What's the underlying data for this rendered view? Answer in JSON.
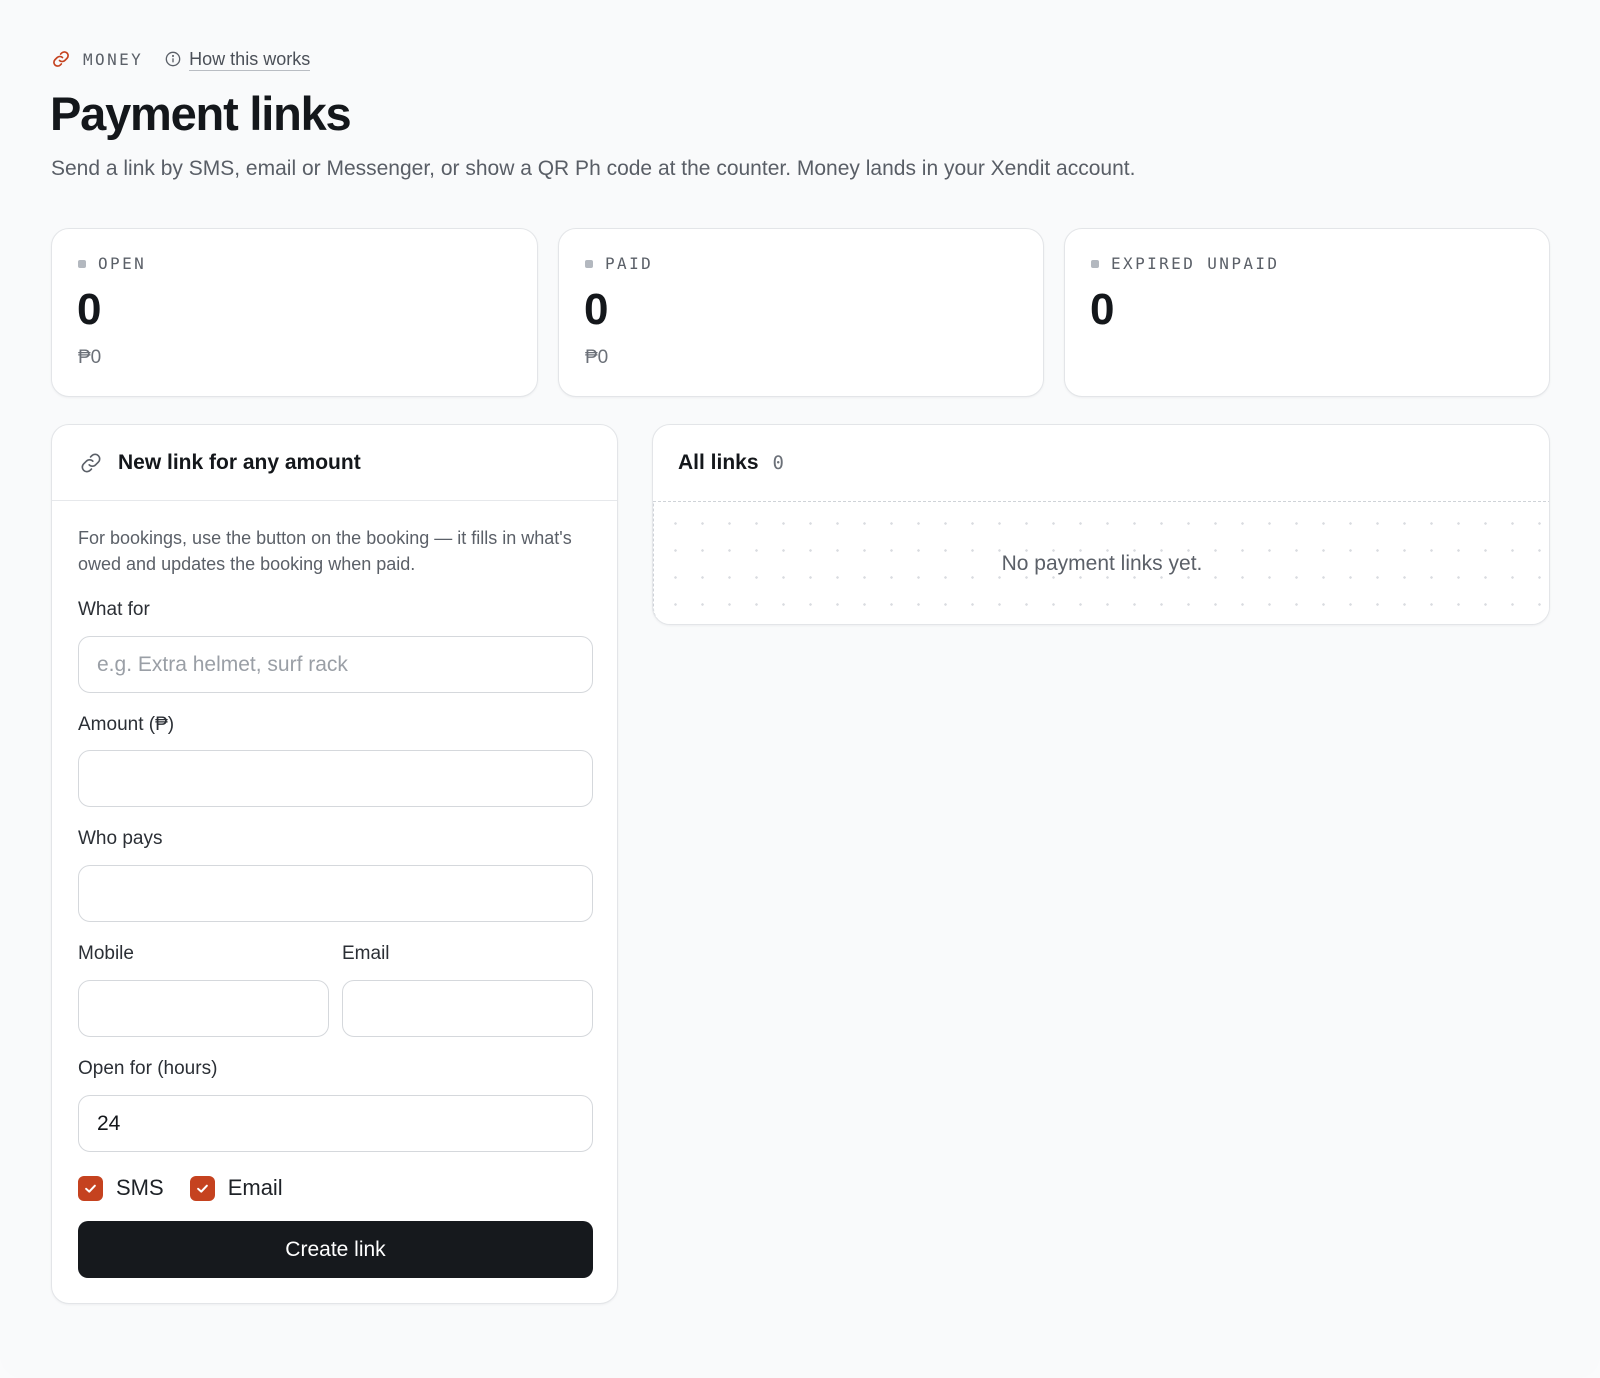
{
  "header": {
    "section_label": "MONEY",
    "how_link": "How this works",
    "title": "Payment links",
    "subtitle": "Send a link by SMS, email or Messenger, or show a QR Ph code at the counter. Money lands in your Xendit account."
  },
  "stats": [
    {
      "label": "OPEN",
      "count": "0",
      "amount": "₱0"
    },
    {
      "label": "PAID",
      "count": "0",
      "amount": "₱0"
    },
    {
      "label": "EXPIRED UNPAID",
      "count": "0"
    }
  ],
  "form": {
    "heading": "New link for any amount",
    "hint": "For bookings, use the button on the booking — it fills in what's owed and updates the booking when paid.",
    "what_for": {
      "label": "What for",
      "placeholder": "e.g. Extra helmet, surf rack",
      "value": ""
    },
    "amount": {
      "label": "Amount (₱)",
      "value": ""
    },
    "who_pays": {
      "label": "Who pays",
      "value": ""
    },
    "mobile": {
      "label": "Mobile",
      "value": ""
    },
    "email": {
      "label": "Email",
      "value": ""
    },
    "open_for": {
      "label": "Open for (hours)",
      "value": "24"
    },
    "channels": [
      {
        "label": "SMS",
        "checked": true
      },
      {
        "label": "Email",
        "checked": true
      }
    ],
    "submit_label": "Create link"
  },
  "links": {
    "heading": "All links",
    "count": "0",
    "empty_text": "No payment links yet."
  },
  "colors": {
    "accent": "#c5421f",
    "button": "#16191d",
    "background": "#f9fafb"
  },
  "icons": {
    "section": "link-icon",
    "how": "info-icon",
    "form_heading": "link-icon",
    "checkbox": "check-icon"
  }
}
